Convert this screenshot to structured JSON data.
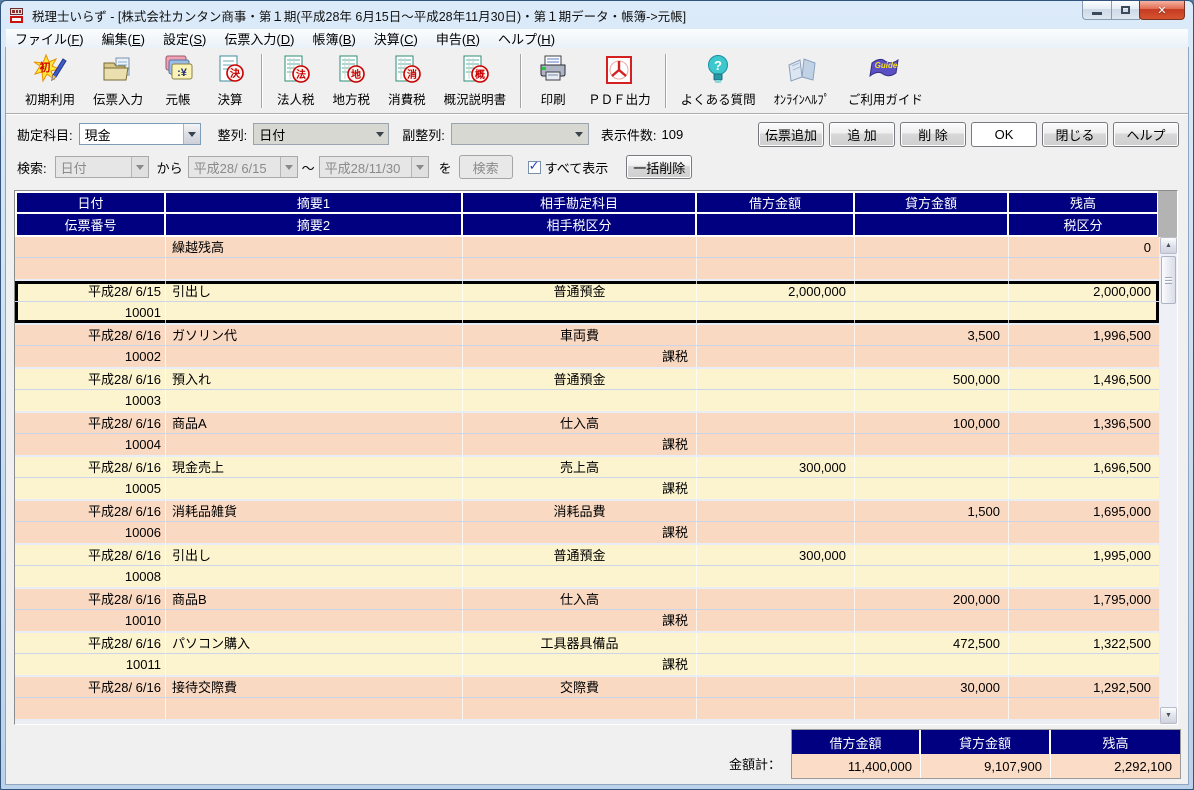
{
  "window": {
    "title": "税理士いらず - [株式会社カンタン商事・第１期(平成28年 6月15日～平成28年11月30日)・第１期データ・帳簿->元帳]"
  },
  "menubar": {
    "items": [
      "ファイル(F)",
      "編集(E)",
      "設定(S)",
      "伝票入力(D)",
      "帳簿(B)",
      "決算(C)",
      "申告(R)",
      "ヘルプ(H)"
    ]
  },
  "toolbar": {
    "groups": [
      [
        {
          "label": "初期利用",
          "icon": "init-icon"
        },
        {
          "label": "伝票入力",
          "icon": "voucher-input-icon"
        },
        {
          "label": "元帳",
          "icon": "ledger-icon"
        },
        {
          "label": "決算",
          "icon": "settlement-icon"
        }
      ],
      [
        {
          "label": "法人税",
          "icon": "corporate-tax-icon"
        },
        {
          "label": "地方税",
          "icon": "local-tax-icon"
        },
        {
          "label": "消費税",
          "icon": "consumption-tax-icon"
        },
        {
          "label": "概況説明書",
          "icon": "overview-report-icon"
        }
      ],
      [
        {
          "label": "印刷",
          "icon": "print-icon"
        },
        {
          "label": "ＰＤＦ出力",
          "icon": "pdf-export-icon"
        }
      ],
      [
        {
          "label": "よくある質問",
          "icon": "faq-icon"
        },
        {
          "label": "ｵﾝﾗｲﾝﾍﾙﾌﾟ",
          "icon": "online-help-icon"
        },
        {
          "label": "ご利用ガイド",
          "icon": "user-guide-icon"
        }
      ]
    ]
  },
  "filters": {
    "account_label": "勘定科目:",
    "account_value": "現金",
    "sort_label": "整列:",
    "sort_value": "日付",
    "subsort_label": "副整列:",
    "subsort_value": "",
    "count_label": "表示件数:",
    "count_value": "109",
    "buttons": [
      {
        "label": "伝票追加",
        "name": "add-voucher-button"
      },
      {
        "label": "追 加",
        "name": "add-button"
      },
      {
        "label": "削 除",
        "name": "delete-button"
      },
      {
        "label": "OK",
        "name": "ok-button"
      },
      {
        "label": "閉じる",
        "name": "close-button"
      },
      {
        "label": "ヘルプ",
        "name": "help-button"
      }
    ]
  },
  "search": {
    "label": "検索:",
    "field_value": "日付",
    "from_label": "から",
    "date_from": "平成28/ 6/15",
    "tilde": "～",
    "date_to": "平成28/11/30",
    "wo_label": "を",
    "search_button": "検索",
    "show_all_label": "すべて表示",
    "show_all_checked": true,
    "bulk_delete_button": "一括削除"
  },
  "table": {
    "header_row1": [
      "日付",
      "摘要1",
      "相手勘定科目",
      "借方金額",
      "貸方金額",
      "残高"
    ],
    "header_row2": [
      "伝票番号",
      "摘要2",
      "相手税区分",
      "",
      "",
      "税区分"
    ],
    "entries": [
      {
        "date": "",
        "desc1": "繰越残高",
        "account": "",
        "debit": "",
        "credit": "",
        "balance": "0",
        "number": "",
        "tax": "",
        "tone": "pink",
        "selected": false
      },
      {
        "date": "平成28/ 6/15",
        "desc1": "引出し",
        "account": "普通預金",
        "debit": "2,000,000",
        "credit": "",
        "balance": "2,000,000",
        "number": "10001",
        "tax": "",
        "tone": "cream",
        "selected": true
      },
      {
        "date": "平成28/ 6/16",
        "desc1": "ガソリン代",
        "account": "車両費",
        "debit": "",
        "credit": "3,500",
        "balance": "1,996,500",
        "number": "10002",
        "tax": "課税",
        "tone": "pink",
        "selected": false
      },
      {
        "date": "平成28/ 6/16",
        "desc1": "預入れ",
        "account": "普通預金",
        "debit": "",
        "credit": "500,000",
        "balance": "1,496,500",
        "number": "10003",
        "tax": "",
        "tone": "cream",
        "selected": false
      },
      {
        "date": "平成28/ 6/16",
        "desc1": "商品A",
        "account": "仕入高",
        "debit": "",
        "credit": "100,000",
        "balance": "1,396,500",
        "number": "10004",
        "tax": "課税",
        "tone": "pink",
        "selected": false
      },
      {
        "date": "平成28/ 6/16",
        "desc1": "現金売上",
        "account": "売上高",
        "debit": "300,000",
        "credit": "",
        "balance": "1,696,500",
        "number": "10005",
        "tax": "課税",
        "tone": "cream",
        "selected": false
      },
      {
        "date": "平成28/ 6/16",
        "desc1": "消耗品雑貨",
        "account": "消耗品費",
        "debit": "",
        "credit": "1,500",
        "balance": "1,695,000",
        "number": "10006",
        "tax": "課税",
        "tone": "pink",
        "selected": false
      },
      {
        "date": "平成28/ 6/16",
        "desc1": "引出し",
        "account": "普通預金",
        "debit": "300,000",
        "credit": "",
        "balance": "1,995,000",
        "number": "10008",
        "tax": "",
        "tone": "cream",
        "selected": false
      },
      {
        "date": "平成28/ 6/16",
        "desc1": "商品B",
        "account": "仕入高",
        "debit": "",
        "credit": "200,000",
        "balance": "1,795,000",
        "number": "10010",
        "tax": "課税",
        "tone": "pink",
        "selected": false
      },
      {
        "date": "平成28/ 6/16",
        "desc1": "パソコン購入",
        "account": "工具器具備品",
        "debit": "",
        "credit": "472,500",
        "balance": "1,322,500",
        "number": "10011",
        "tax": "課税",
        "tone": "cream",
        "selected": false
      },
      {
        "date": "平成28/ 6/16",
        "desc1": "接待交際費",
        "account": "交際費",
        "debit": "",
        "credit": "30,000",
        "balance": "1,292,500",
        "number": "",
        "tax": "",
        "tone": "pink",
        "selected": false
      }
    ]
  },
  "footer": {
    "total_label": "金額計：",
    "columns": [
      "借方金額",
      "貸方金額",
      "残高"
    ],
    "values": [
      "11,400,000",
      "9,107,900",
      "2,292,100"
    ]
  },
  "colors": {
    "header_navy": "#000080",
    "row_pink": "#FAD9C2",
    "row_cream": "#FCF3CF",
    "selected_border": "#000000",
    "close_button_red": "#C8482B",
    "stamp_red": "#C80000"
  }
}
